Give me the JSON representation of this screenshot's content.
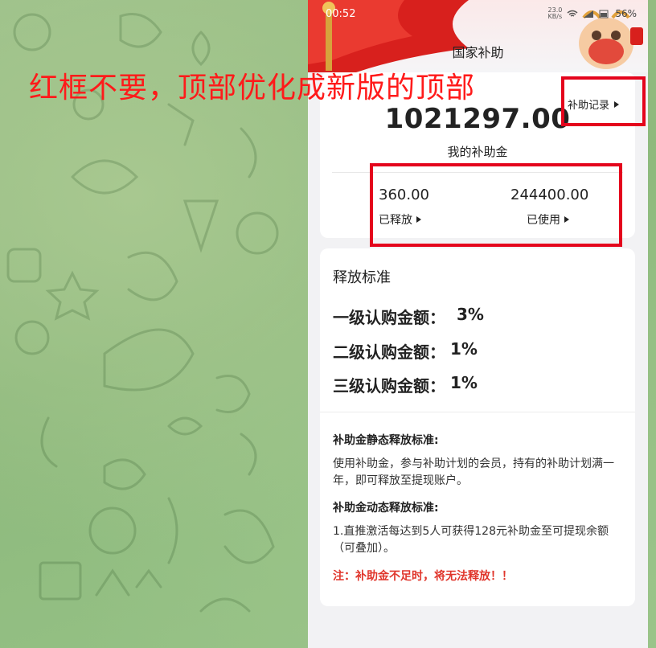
{
  "annotation": {
    "text": "红框不要，顶部优化成新版的顶部",
    "color": "#ff1a1a"
  },
  "status_bar": {
    "time": "00:52",
    "network_speed": "23.0\nKB/s",
    "battery": "56%"
  },
  "header": {
    "title": "国家补助"
  },
  "summary": {
    "records_label": "补助记录",
    "total_amount": "1021297.00",
    "total_label": "我的补助金",
    "released_value": "360.00",
    "released_label": "已释放",
    "used_value": "244400.00",
    "used_label": "已使用"
  },
  "rules": {
    "title": "释放标准",
    "tiers": [
      {
        "label": "一级认购金额：",
        "value": "3%"
      },
      {
        "label": "二级认购金额：",
        "value": "1%"
      },
      {
        "label": "三级认购金额：",
        "value": "1%"
      }
    ],
    "static_heading": "补助金静态释放标准:",
    "static_body": "使用补助金，参与补助计划的会员，持有的补助计划满一年，即可释放至提现账户。",
    "dynamic_heading": "补助金动态释放标准:",
    "dynamic_body": "1.直推激活每达到5人可获得128元补助金至可提现余额（可叠加）。",
    "note": "注：补助金不足时，将无法释放！！"
  },
  "colors": {
    "highlight_box": "#e4041c",
    "note_red": "#e0362c",
    "chat_background": "#8fb87f"
  }
}
